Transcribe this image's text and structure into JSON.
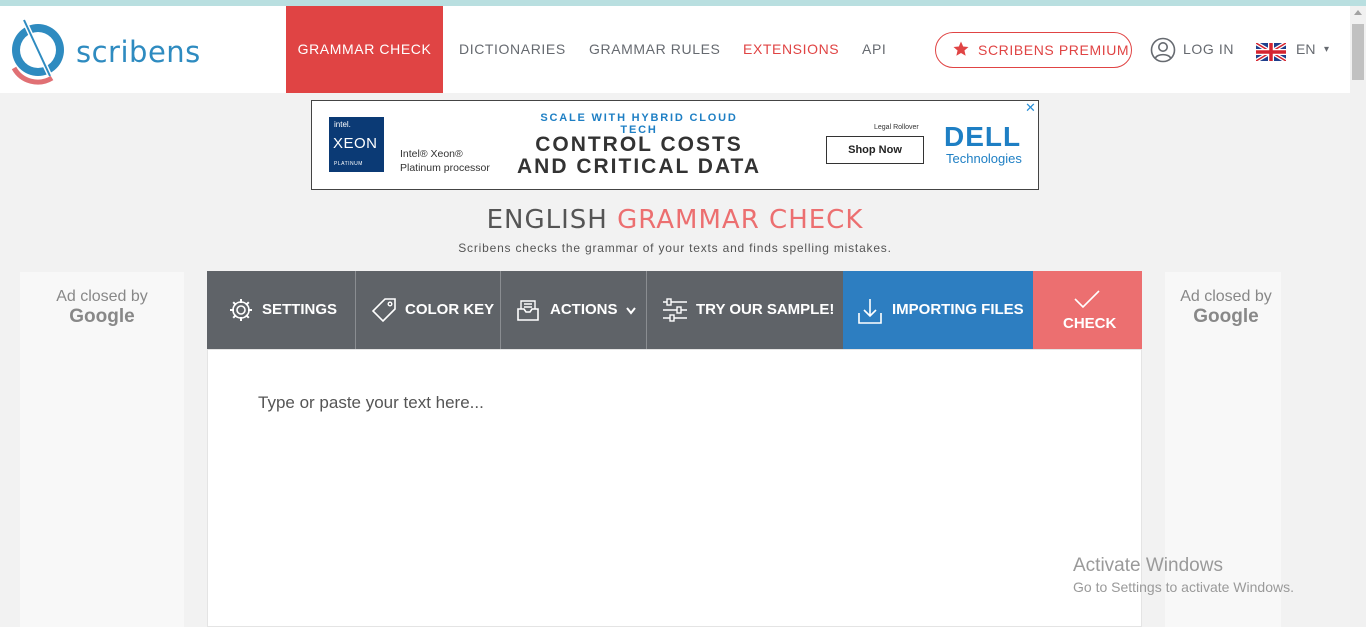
{
  "brand": {
    "name": "scribens"
  },
  "nav": {
    "items": [
      {
        "label": "GRAMMAR CHECK"
      },
      {
        "label": "DICTIONARIES"
      },
      {
        "label": "GRAMMAR RULES"
      },
      {
        "label": "EXTENSIONS"
      },
      {
        "label": "API"
      }
    ],
    "premium_label": "SCRIBENS PREMIUM",
    "login_label": "LOG IN",
    "lang_label": "EN",
    "lang_caret": "▾"
  },
  "ad": {
    "close": "✕",
    "intel": "intel.",
    "xeon": "XEON",
    "platinum": "PLATINUM",
    "processor_line1": "Intel® Xeon®",
    "processor_line2": "Platinum processor",
    "tagline": "SCALE WITH HYBRID CLOUD TECH",
    "headline_line1": "CONTROL COSTS",
    "headline_line2": "AND CRITICAL DATA",
    "legal": "Legal Rollover",
    "shop_button": "Shop Now",
    "dell": "DELL",
    "dell_tech": "Technologies"
  },
  "page": {
    "title_part1": "ENGLISH",
    "title_part2": "GRAMMAR CHECK",
    "subtitle": "Scribens checks the grammar of your texts and finds spelling mistakes."
  },
  "side_ads": {
    "closed_by": "Ad closed by",
    "google": "Google"
  },
  "toolbar": {
    "settings": "SETTINGS",
    "color_key": "COLOR KEY",
    "actions": "ACTIONS",
    "sample": "TRY OUR SAMPLE!",
    "importing": "IMPORTING FILES",
    "check": "CHECK"
  },
  "editor": {
    "placeholder": "Type or paste your text here..."
  },
  "watermark": {
    "line1": "Activate Windows",
    "line2": "Go to Settings to activate Windows."
  },
  "colors": {
    "accent_red": "#e04444",
    "check_red": "#ec6f70",
    "toolbar_gray": "#5f6368",
    "import_blue": "#2d7ec1",
    "brand_blue": "#2e8bc0"
  }
}
